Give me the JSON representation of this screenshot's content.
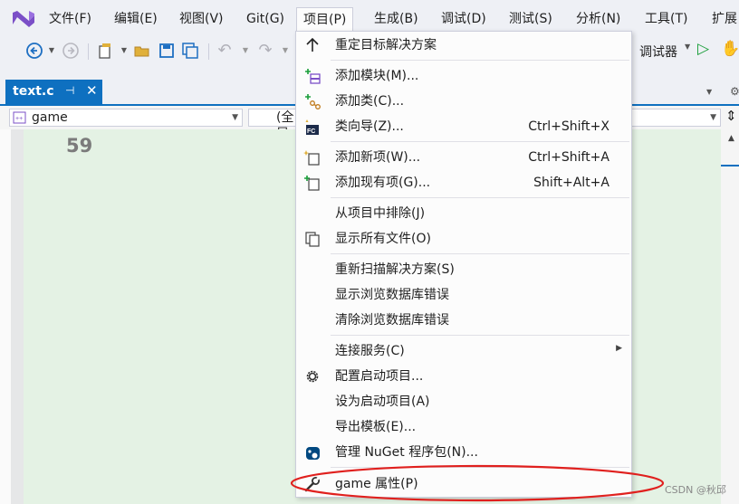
{
  "menubar": {
    "items": [
      "文件(F)",
      "编辑(E)",
      "视图(V)",
      "Git(G)",
      "项目(P)",
      "生成(B)",
      "调试(D)",
      "测试(S)",
      "分析(N)",
      "工具(T)",
      "扩展"
    ]
  },
  "toolbar": {
    "debugger_label": "调试器"
  },
  "tab": {
    "label": "text.c"
  },
  "nav": {
    "left_combo": "game",
    "middle_combo": "(全局"
  },
  "editor": {
    "line_number": "59"
  },
  "menu": {
    "items": [
      {
        "label": "重定目标解决方案",
        "shortcut": "",
        "icon": "arrow-up-icon"
      },
      {
        "label": "添加模块(M)...",
        "shortcut": "",
        "icon": "add-module-icon"
      },
      {
        "label": "添加类(C)...",
        "shortcut": "",
        "icon": "add-class-icon"
      },
      {
        "label": "类向导(Z)...",
        "shortcut": "Ctrl+Shift+X",
        "icon": "class-wizard-icon"
      },
      {
        "label": "添加新项(W)...",
        "shortcut": "Ctrl+Shift+A",
        "icon": "add-new-item-icon"
      },
      {
        "label": "添加现有项(G)...",
        "shortcut": "Shift+Alt+A",
        "icon": "add-existing-item-icon"
      },
      {
        "label": "从项目中排除(J)",
        "shortcut": "",
        "icon": ""
      },
      {
        "label": "显示所有文件(O)",
        "shortcut": "",
        "icon": "show-all-files-icon"
      },
      {
        "label": "重新扫描解决方案(S)",
        "shortcut": "",
        "icon": ""
      },
      {
        "label": "显示浏览数据库错误",
        "shortcut": "",
        "icon": ""
      },
      {
        "label": "清除浏览数据库错误",
        "shortcut": "",
        "icon": ""
      },
      {
        "label": "连接服务(C)",
        "shortcut": "",
        "icon": ""
      },
      {
        "label": "配置启动项目...",
        "shortcut": "",
        "icon": "gear-icon"
      },
      {
        "label": "设为启动项目(A)",
        "shortcut": "",
        "icon": ""
      },
      {
        "label": "导出模板(E)...",
        "shortcut": "",
        "icon": ""
      },
      {
        "label": "管理 NuGet 程序包(N)...",
        "shortcut": "",
        "icon": "nuget-icon"
      },
      {
        "label": "game 属性(P)",
        "shortcut": "",
        "icon": "wrench-icon"
      }
    ]
  },
  "watermark": "CSDN @秋邱",
  "colors": {
    "accent": "#0e70c0",
    "vs_purple": "#7b4fc7",
    "highlight_red": "#e0201e",
    "editor_bg": "#e4f2e4"
  }
}
